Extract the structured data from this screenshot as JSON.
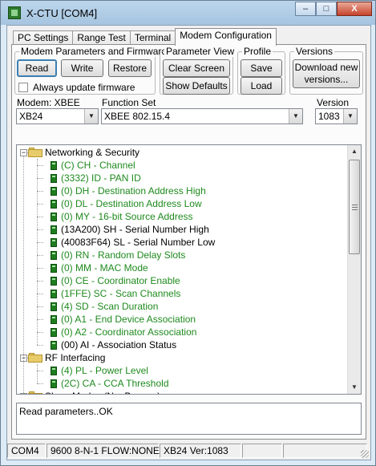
{
  "window": {
    "title": "X-CTU  [COM4]",
    "buttons": {
      "minimize": "–",
      "maximize": "□",
      "close": "X"
    }
  },
  "tabs": [
    {
      "label": "PC Settings"
    },
    {
      "label": "Range Test"
    },
    {
      "label": "Terminal"
    },
    {
      "label": "Modem Configuration",
      "active": true
    }
  ],
  "modem_params": {
    "legend": "Modem Parameters and Firmware",
    "read": "Read",
    "write": "Write",
    "restore": "Restore",
    "always_update": "Always update firmware",
    "always_update_checked": false
  },
  "parameter_view": {
    "legend": "Parameter View",
    "clear_screen": "Clear Screen",
    "show_defaults": "Show Defaults"
  },
  "profile": {
    "legend": "Profile",
    "save": "Save",
    "load": "Load"
  },
  "versions": {
    "legend": "Versions",
    "download_line1": "Download new",
    "download_line2": "versions..."
  },
  "modem": {
    "label": "Modem: XBEE",
    "value": "XB24"
  },
  "function_set": {
    "label": "Function Set",
    "value": "XBEE 802.15.4"
  },
  "version": {
    "label": "Version",
    "value": "1083"
  },
  "tree": {
    "groups": [
      {
        "label": "Networking & Security",
        "expanded": true,
        "items": [
          {
            "text": "(C) CH - Channel",
            "color": "green"
          },
          {
            "text": "(3332) ID - PAN ID",
            "color": "green"
          },
          {
            "text": "(0) DH - Destination Address High",
            "color": "green"
          },
          {
            "text": "(0) DL - Destination Address Low",
            "color": "green"
          },
          {
            "text": "(0) MY - 16-bit Source Address",
            "color": "green"
          },
          {
            "text": "(13A200) SH - Serial Number High",
            "color": "black"
          },
          {
            "text": "(40083F64) SL - Serial Number Low",
            "color": "black"
          },
          {
            "text": "(0) RN - Random Delay Slots",
            "color": "green"
          },
          {
            "text": "(0) MM - MAC Mode",
            "color": "green"
          },
          {
            "text": "(0) CE - Coordinator Enable",
            "color": "green"
          },
          {
            "text": "(1FFE) SC - Scan Channels",
            "color": "green"
          },
          {
            "text": "(4) SD - Scan Duration",
            "color": "green"
          },
          {
            "text": "(0) A1 - End Device Association",
            "color": "green"
          },
          {
            "text": "(0) A2 - Coordinator Association",
            "color": "green"
          },
          {
            "text": "(00) AI - Association Status",
            "color": "black"
          }
        ]
      },
      {
        "label": "RF Interfacing",
        "expanded": true,
        "items": [
          {
            "text": "(4) PL - Power Level",
            "color": "green"
          },
          {
            "text": "(2C) CA - CCA Threshold",
            "color": "green"
          }
        ]
      },
      {
        "label": "Sleep Modes (NonBeacon)",
        "expanded": true,
        "items": []
      }
    ]
  },
  "message": "Read parameters..OK",
  "statusbar": {
    "port": "COM4",
    "settings": "9600 8-N-1  FLOW:NONE",
    "modem": "XB24  Ver:1083"
  },
  "colors": {
    "green": "#1e8a1e",
    "black": "#000000"
  }
}
